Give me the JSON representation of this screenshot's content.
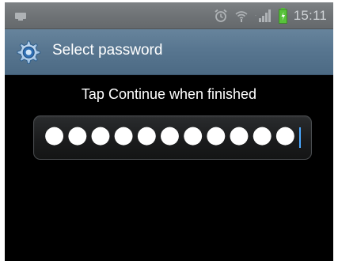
{
  "status_bar": {
    "time": "15:11",
    "icons": [
      "usb-debug-icon",
      "alarm-icon",
      "wifi-icon",
      "signal-icon",
      "battery-icon"
    ],
    "colors": {
      "background": "#6f7376",
      "icon": "#aeb2b5",
      "battery": "#57c23a"
    }
  },
  "title_bar": {
    "title": "Select password",
    "icon": "settings-gear-icon",
    "colors": {
      "background": "#587690",
      "text": "#ffffff"
    }
  },
  "content": {
    "instruction": "Tap Continue when finished",
    "password_field": {
      "value": "●●●●●●●●●●●",
      "cursor_color": "#4aa8ff"
    },
    "background": "#000000"
  }
}
